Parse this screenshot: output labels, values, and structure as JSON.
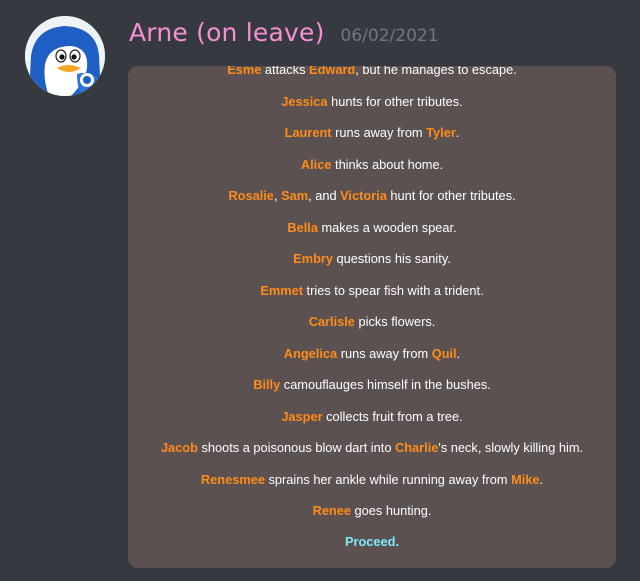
{
  "message": {
    "username": "Arne (on leave)",
    "timestamp": "06/02/2021",
    "username_color": "#f48fd2",
    "avatar_icon": "penguin-avatar-icon"
  },
  "embed": {
    "background": "#5a5150",
    "name_color": "#ff8c1a",
    "link_color": "#7ee8ff",
    "lines": [
      [
        {
          "t": "Esme",
          "n": true
        },
        {
          "t": " attacks "
        },
        {
          "t": "Edward",
          "n": true
        },
        {
          "t": ", but he manages to escape."
        }
      ],
      [
        {
          "t": "Jessica",
          "n": true
        },
        {
          "t": " hunts for other tributes."
        }
      ],
      [
        {
          "t": "Laurent",
          "n": true
        },
        {
          "t": " runs away from "
        },
        {
          "t": "Tyler",
          "n": true
        },
        {
          "t": "."
        }
      ],
      [
        {
          "t": "Alice",
          "n": true
        },
        {
          "t": " thinks about home."
        }
      ],
      [
        {
          "t": "Rosalie",
          "n": true
        },
        {
          "t": ", "
        },
        {
          "t": "Sam",
          "n": true
        },
        {
          "t": ", and "
        },
        {
          "t": "Victoria",
          "n": true
        },
        {
          "t": " hunt for other tributes."
        }
      ],
      [
        {
          "t": "Bella",
          "n": true
        },
        {
          "t": " makes a wooden spear."
        }
      ],
      [
        {
          "t": "Embry",
          "n": true
        },
        {
          "t": " questions his sanity."
        }
      ],
      [
        {
          "t": "Emmet",
          "n": true
        },
        {
          "t": " tries to spear fish with a trident."
        }
      ],
      [
        {
          "t": "Carlisle",
          "n": true
        },
        {
          "t": " picks flowers."
        }
      ],
      [
        {
          "t": "Angelica",
          "n": true
        },
        {
          "t": " runs away from "
        },
        {
          "t": "Quil",
          "n": true
        },
        {
          "t": "."
        }
      ],
      [
        {
          "t": "Billy",
          "n": true
        },
        {
          "t": " camouflauges himself in the bushes."
        }
      ],
      [
        {
          "t": "Jasper",
          "n": true
        },
        {
          "t": " collects fruit from a tree."
        }
      ],
      [
        {
          "t": "Jacob",
          "n": true
        },
        {
          "t": " shoots a poisonous blow dart into "
        },
        {
          "t": "Charlie",
          "n": true
        },
        {
          "t": "'s neck, slowly killing him."
        }
      ],
      [
        {
          "t": "Renesmee",
          "n": true
        },
        {
          "t": " sprains her ankle while running away from "
        },
        {
          "t": "Mike",
          "n": true
        },
        {
          "t": "."
        }
      ],
      [
        {
          "t": "Renee",
          "n": true
        },
        {
          "t": " goes hunting."
        }
      ]
    ],
    "proceed_label": "Proceed."
  }
}
